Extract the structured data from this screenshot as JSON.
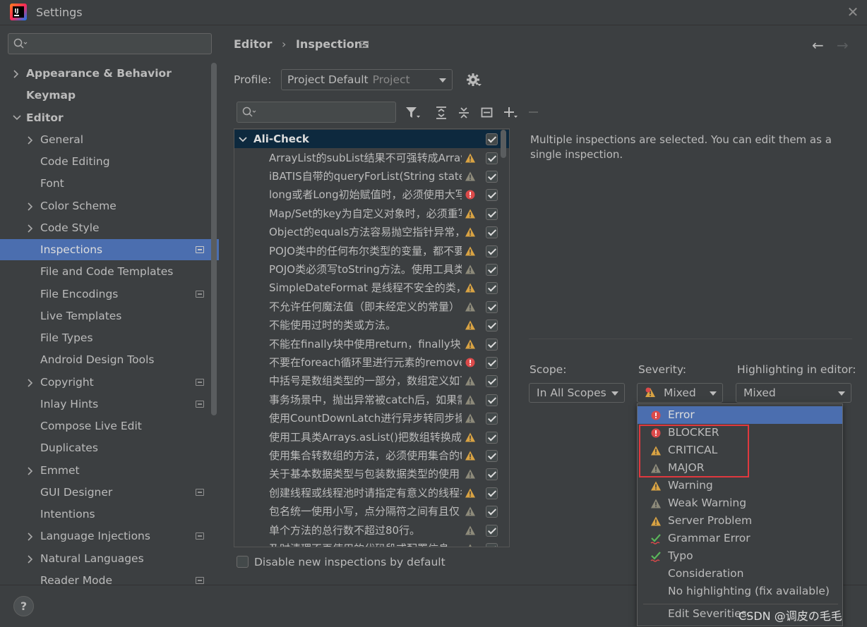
{
  "window": {
    "title": "Settings"
  },
  "sidebar": {
    "items": [
      {
        "label": "Appearance & Behavior",
        "expandable": true,
        "level": 0,
        "bold": true
      },
      {
        "label": "Keymap",
        "expandable": false,
        "level": 0,
        "bold": true
      },
      {
        "label": "Editor",
        "expandable": true,
        "expanded": true,
        "level": 0,
        "bold": true
      },
      {
        "label": "General",
        "expandable": true,
        "level": 1
      },
      {
        "label": "Code Editing",
        "expandable": false,
        "level": 1
      },
      {
        "label": "Font",
        "expandable": false,
        "level": 1
      },
      {
        "label": "Color Scheme",
        "expandable": true,
        "level": 1
      },
      {
        "label": "Code Style",
        "expandable": true,
        "level": 1
      },
      {
        "label": "Inspections",
        "expandable": false,
        "level": 1,
        "selected": true,
        "badge": true
      },
      {
        "label": "File and Code Templates",
        "expandable": false,
        "level": 1
      },
      {
        "label": "File Encodings",
        "expandable": false,
        "level": 1,
        "badge": true
      },
      {
        "label": "Live Templates",
        "expandable": false,
        "level": 1
      },
      {
        "label": "File Types",
        "expandable": false,
        "level": 1
      },
      {
        "label": "Android Design Tools",
        "expandable": false,
        "level": 1
      },
      {
        "label": "Copyright",
        "expandable": true,
        "level": 1,
        "badge": true
      },
      {
        "label": "Inlay Hints",
        "expandable": false,
        "level": 1,
        "badge": true
      },
      {
        "label": "Compose Live Edit",
        "expandable": false,
        "level": 1
      },
      {
        "label": "Duplicates",
        "expandable": false,
        "level": 1
      },
      {
        "label": "Emmet",
        "expandable": true,
        "level": 1
      },
      {
        "label": "GUI Designer",
        "expandable": false,
        "level": 1,
        "badge": true
      },
      {
        "label": "Intentions",
        "expandable": false,
        "level": 1
      },
      {
        "label": "Language Injections",
        "expandable": true,
        "level": 1,
        "badge": true
      },
      {
        "label": "Natural Languages",
        "expandable": true,
        "level": 1
      },
      {
        "label": "Reader Mode",
        "expandable": false,
        "level": 1,
        "badge": true
      }
    ]
  },
  "breadcrumb": {
    "part1": "Editor",
    "sep": "›",
    "part2": "Inspections"
  },
  "profile": {
    "label": "Profile:",
    "value": "Project Default",
    "sub": "Project"
  },
  "tree": {
    "group": "Ali-Check",
    "rows": [
      {
        "text": "ArrayList的subList结果不可强转成Array",
        "sev": "warn"
      },
      {
        "text": "iBATIS自带的queryForList(String state",
        "sev": "weak"
      },
      {
        "text": "long或者Long初始赋值时，必须使用大写",
        "sev": "error"
      },
      {
        "text": "Map/Set的key为自定义对象时，必须重写",
        "sev": "warn"
      },
      {
        "text": "Object的equals方法容易抛空指针异常，",
        "sev": "warn"
      },
      {
        "text": "POJO类中的任何布尔类型的变量，都不要",
        "sev": "warn"
      },
      {
        "text": "POJO类必须写toString方法。使用工具类",
        "sev": "weak"
      },
      {
        "text": "SimpleDateFormat 是线程不安全的类，",
        "sev": "warn"
      },
      {
        "text": "不允许任何魔法值（即未经定义的常量）",
        "sev": "weak"
      },
      {
        "text": "不能使用过时的类或方法。",
        "sev": "warn"
      },
      {
        "text": "不能在finally块中使用return，finally块中",
        "sev": "warn"
      },
      {
        "text": "不要在foreach循环里进行元素的remove",
        "sev": "error"
      },
      {
        "text": "中括号是数组类型的一部分，数组定义如下",
        "sev": "weak"
      },
      {
        "text": "事务场景中，抛出异常被catch后，如果需",
        "sev": "weak"
      },
      {
        "text": "使用CountDownLatch进行异步转同步操",
        "sev": "weak"
      },
      {
        "text": "使用工具类Arrays.asList()把数组转换成集",
        "sev": "warn"
      },
      {
        "text": "使用集合转数组的方法，必须使用集合的t",
        "sev": "warn"
      },
      {
        "text": "关于基本数据类型与包装数据类型的使用",
        "sev": "weak"
      },
      {
        "text": "创建线程或线程池时请指定有意义的线程名",
        "sev": "warn"
      },
      {
        "text": "包名统一使用小写，点分隔符之间有且仅",
        "sev": "weak"
      },
      {
        "text": "单个方法的总行数不超过80行。",
        "sev": "weak"
      },
      {
        "text": "及时清理不再使用的代码段或配置信息",
        "sev": "weak"
      }
    ]
  },
  "disable_new": {
    "label": "Disable new inspections by default"
  },
  "info": {
    "text": "Multiple inspections are selected. You can edit them as a single inspection."
  },
  "scope": {
    "label": "Scope:",
    "value": "In All Scopes"
  },
  "severity": {
    "label": "Severity:",
    "value": "Mixed"
  },
  "highlighting": {
    "label": "Highlighting in editor:",
    "value": "Mixed"
  },
  "severity_options": [
    {
      "label": "Error",
      "icon": "error",
      "selected": true
    },
    {
      "label": "BLOCKER",
      "icon": "error"
    },
    {
      "label": "CRITICAL",
      "icon": "warn"
    },
    {
      "label": "MAJOR",
      "icon": "weak"
    },
    {
      "label": "Warning",
      "icon": "warn"
    },
    {
      "label": "Weak Warning",
      "icon": "weak"
    },
    {
      "label": "Server Problem",
      "icon": "warn"
    },
    {
      "label": "Grammar Error",
      "icon": "grammar"
    },
    {
      "label": "Typo",
      "icon": "grammar"
    },
    {
      "label": "Consideration",
      "icon": "none"
    },
    {
      "label": "No highlighting (fix available)",
      "icon": "none"
    }
  ],
  "edit_severities": "Edit Severities...",
  "help": "?",
  "watermark": "CSDN @调皮の毛毛",
  "colors": {
    "selection": "#4b6eaf",
    "error": "#db4a4a",
    "warning": "#d9a343",
    "weak": "#8d8a7a",
    "highlight_box": "#e0383e"
  }
}
